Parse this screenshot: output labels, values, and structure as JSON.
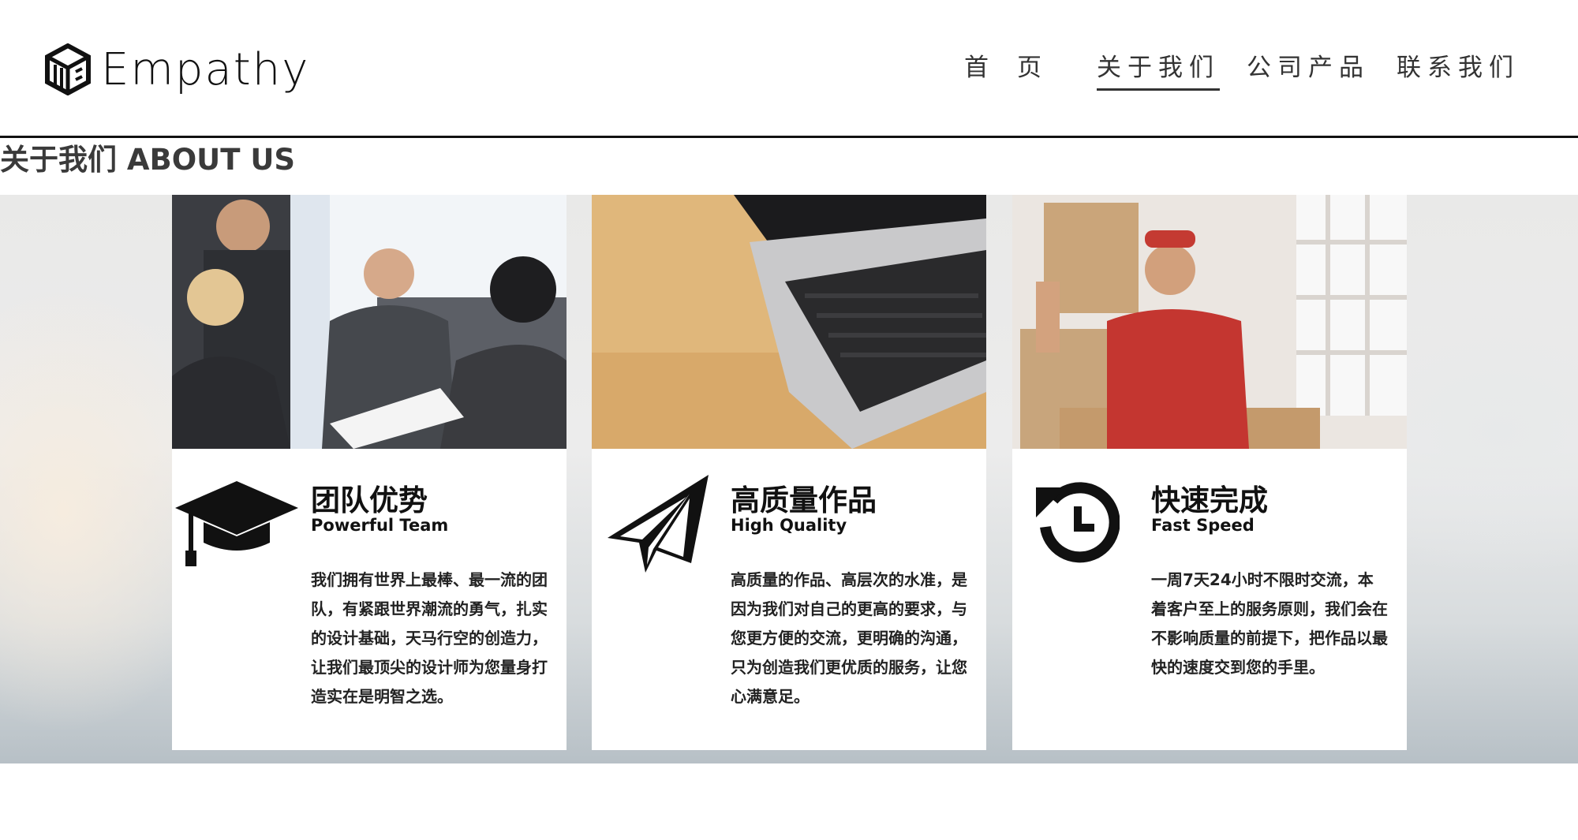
{
  "header": {
    "logo_text": "Empathy",
    "nav": [
      {
        "label": "首页",
        "active": false
      },
      {
        "label": "关于我们",
        "active": true
      },
      {
        "label": "公司产品",
        "active": false
      },
      {
        "label": "联系我们",
        "active": false
      }
    ]
  },
  "section": {
    "title": "关于我们 ABOUT US"
  },
  "cards": [
    {
      "icon": "graduation-cap-icon",
      "title_zh": "团队优势",
      "title_en": "Powerful Team",
      "desc": "我们拥有世界上最棒、最一流的团队，有紧跟世界潮流的勇气，扎实的设计基础，天马行空的创造力，让我们最顶尖的设计师为您量身打造实在是明智之选。"
    },
    {
      "icon": "paper-plane-icon",
      "title_zh": "高质量作品",
      "title_en": "High Quality",
      "desc": "高质量的作品、高层次的水准，是因为我们对自己的更高的要求，与您更方便的交流，更明确的沟通，只为创造我们更优质的服务，让您心满意足。"
    },
    {
      "icon": "clock-history-icon",
      "title_zh": "快速完成",
      "title_en": "Fast Speed",
      "desc": "一周7天24小时不限时交流，本着客户至上的服务原则，我们会在不影响质量的前提下，把作品以最快的速度交到您的手里。"
    }
  ]
}
